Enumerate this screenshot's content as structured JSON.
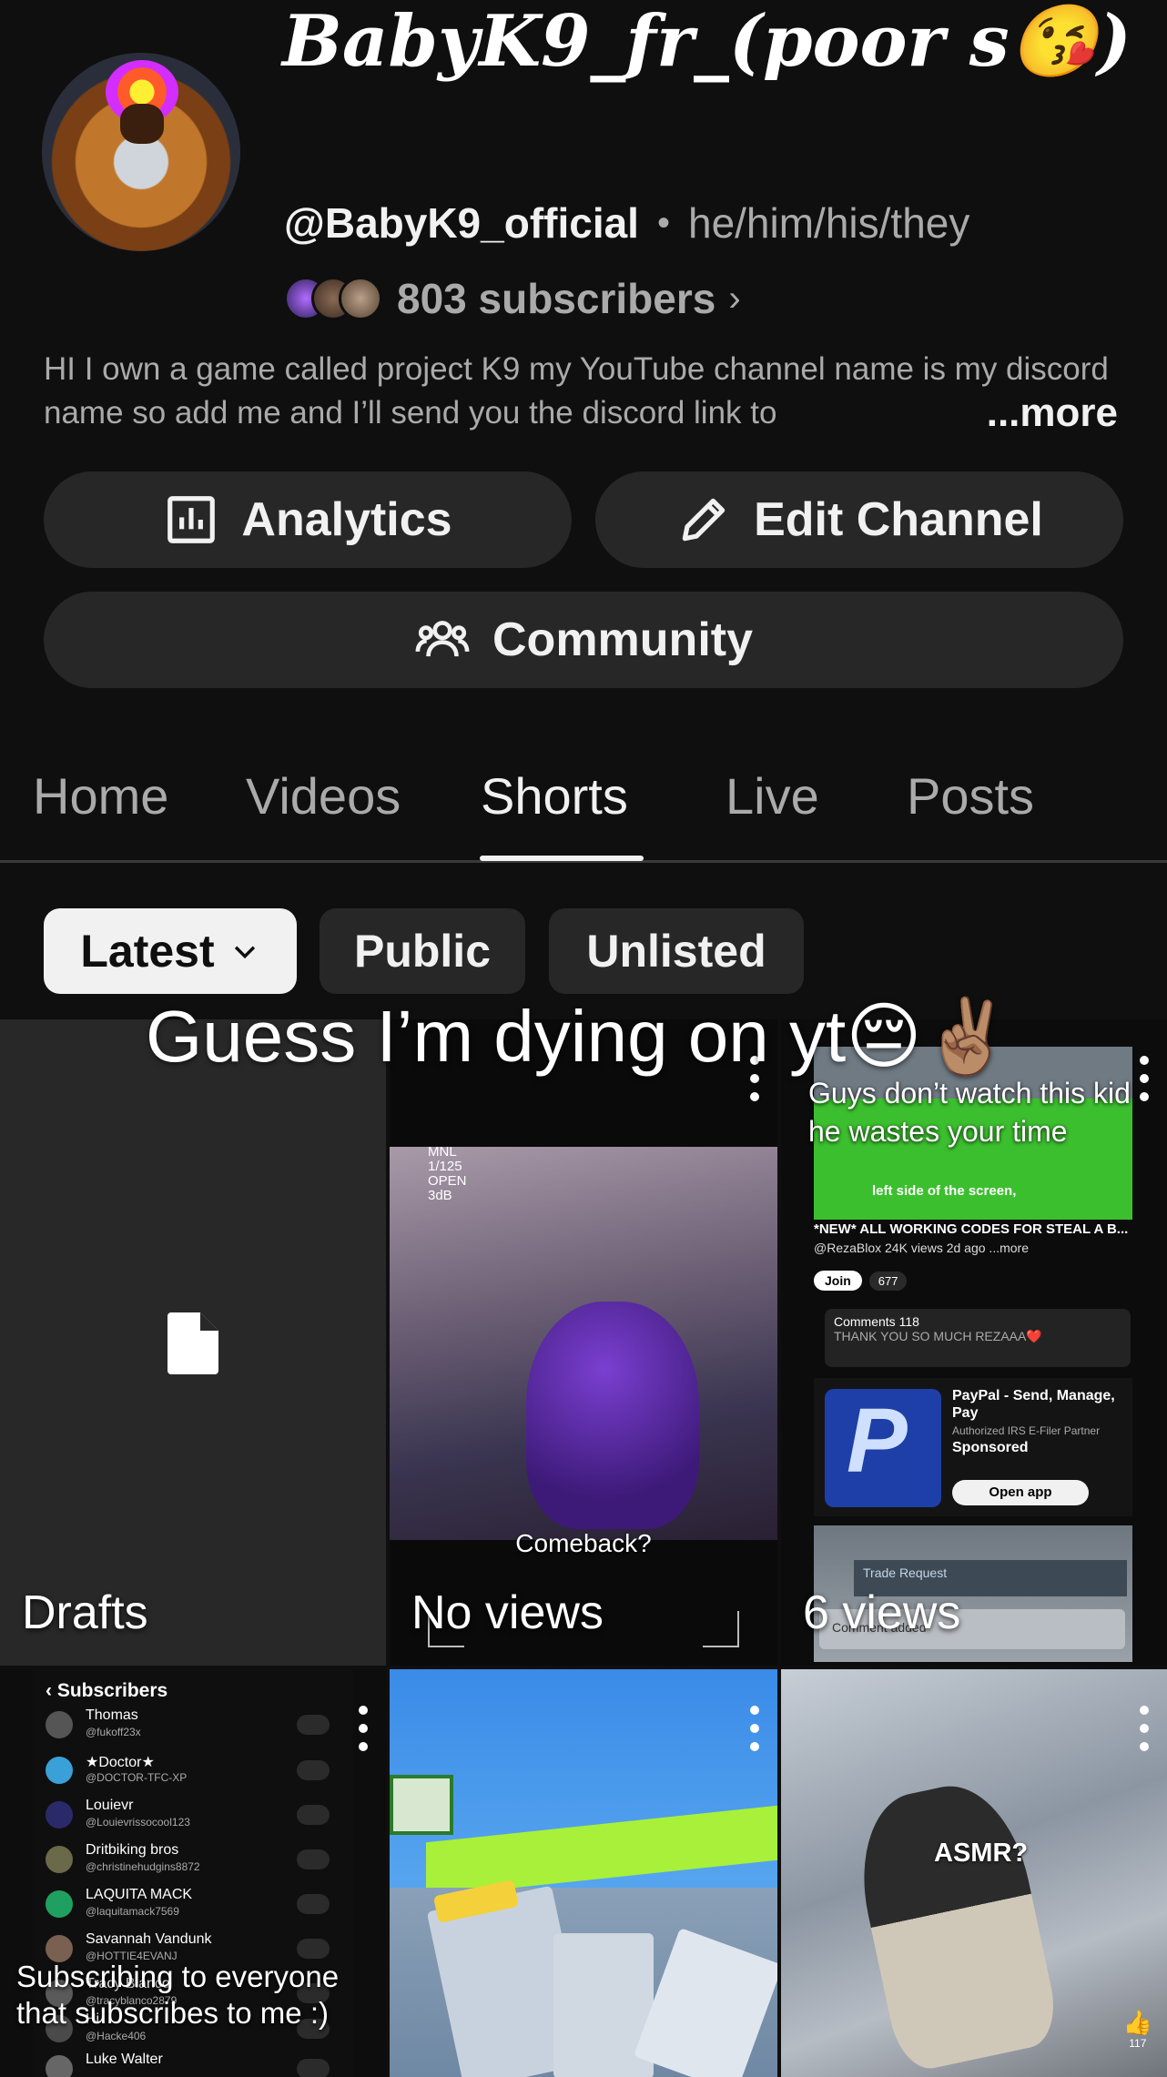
{
  "header": {
    "channel_title": "BabyK9_fr_(poor s😘)",
    "handle": "@BabyK9_official",
    "separator": "•",
    "pronouns": "he/him/his/they",
    "subscribers": "803 subscribers",
    "subscribers_chevron": "›",
    "description": "HI I own a game called project K9 my YouTube channel name is my discord name so add me and I’ll send you the discord link to",
    "more_label": "...more"
  },
  "buttons": {
    "analytics": "Analytics",
    "edit_channel": "Edit Channel",
    "community": "Community"
  },
  "tabs": [
    {
      "label": "Home"
    },
    {
      "label": "Videos"
    },
    {
      "label": "Shorts"
    },
    {
      "label": "Live"
    },
    {
      "label": "Posts"
    }
  ],
  "active_tab": "Shorts",
  "chips": {
    "latest": "Latest",
    "public": "Public",
    "unlisted": "Unlisted"
  },
  "overlay_title": "Guess I’m dying on yt😔✌🏽",
  "shorts": [
    {
      "label": "Drafts"
    },
    {
      "label": "No views",
      "thumb_text": "Comeback?",
      "mnl": "MNL\n1/125\nOPEN\n3dB"
    },
    {
      "label": "6 views",
      "thumb_text": "Guys don’t watch this kid he wastes your time",
      "caption": "left side of the screen,",
      "video_title": "*NEW* ALL WORKING CODES FOR STEAL A B...",
      "video_meta": "@RezaBlox 24K views 2d ago ...more",
      "join": "Join",
      "likes": "677",
      "comments_header": "Comments 118",
      "comment_text": "THANK YOU SO MUCH REZAAA❤️",
      "ad_title": "PayPal - Send, Manage, Pay",
      "ad_sub": "Authorized IRS E-Filer Partner",
      "ad_sponsored": "Sponsored",
      "ad_button": "Open app",
      "trade": "Trade Request",
      "comment_added": "Comment added"
    },
    {
      "thumb_caption": "Subscribing to everyone that subscribes to me :)",
      "panel_title": "Subscribers",
      "rows": [
        {
          "name": "Thomas",
          "handle": "@fukoff23x"
        },
        {
          "name": "★Doctor★",
          "handle": "@DOCTOR-TFC-XP"
        },
        {
          "name": "Louievr",
          "handle": "@Louievrissocool123"
        },
        {
          "name": "Dritbiking bros",
          "handle": "@christinehudgins8872"
        },
        {
          "name": "LAQUITA MACK",
          "handle": "@laquitamack7569"
        },
        {
          "name": "Savannah Vandunk",
          "handle": "@HOTTIE4EVANJ"
        },
        {
          "name": "Tracy Blanco",
          "handle": "@tracyblanco2879"
        },
        {
          "name": "Hi",
          "handle": "@Hacke406"
        },
        {
          "name": "Luke Walter",
          "handle": ""
        }
      ]
    },
    {
      "thumb_text": ""
    },
    {
      "thumb_text": "ASMR?",
      "likes": "117"
    }
  ]
}
